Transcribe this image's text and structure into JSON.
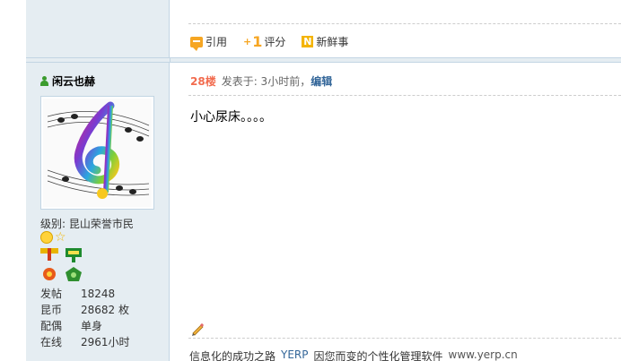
{
  "actions": {
    "quote": "引用",
    "rate_prefix": "+",
    "rate_number": "1",
    "rate": "评分",
    "news_letter": "N",
    "news": "新鲜事"
  },
  "user": {
    "name": "闲云也赫",
    "level_label": "级别:",
    "level": "昆山荣誉市民",
    "stats": [
      {
        "key": "发帖",
        "value": "18248"
      },
      {
        "key": "昆币",
        "value": "28682 枚"
      },
      {
        "key": "配偶",
        "value": "单身"
      },
      {
        "key": "在线",
        "value": "2961小时"
      }
    ]
  },
  "post": {
    "floor": "28楼",
    "posted": "发表于: 3小时前，",
    "edit": "编辑",
    "body": "小心尿床。。。。"
  },
  "signature": {
    "part1": "信息化的成功之路",
    "part2": "YERP",
    "part3": "因您而变的个性化管理软件",
    "part4": "www.yerp.cn"
  },
  "colors": {
    "sidebar_bg": "#e5edf2",
    "border": "#c2d5e3",
    "floor": "#f26c4f",
    "link": "#336699",
    "icon_orange": "#f6a623"
  }
}
